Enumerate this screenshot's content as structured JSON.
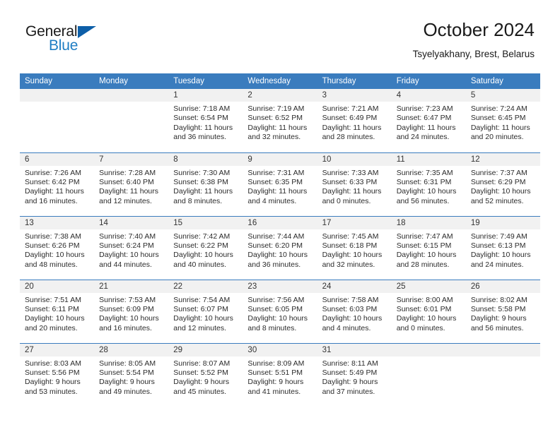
{
  "brand": {
    "name_part1": "General",
    "name_part2": "Blue",
    "triangle_color": "#0d5fa8",
    "blue_color": "#1f7ec4"
  },
  "header": {
    "title": "October 2024",
    "subtitle": "Tsyelyakhany, Brest, Belarus"
  },
  "theme": {
    "header_blue": "#3a7cbe",
    "daynum_gray": "#f1f1f1",
    "text": "#2b2b2b"
  },
  "weekdays": [
    "Sunday",
    "Monday",
    "Tuesday",
    "Wednesday",
    "Thursday",
    "Friday",
    "Saturday"
  ],
  "weeks": [
    [
      {
        "day": "",
        "blank": true
      },
      {
        "day": "",
        "blank": true
      },
      {
        "day": "1",
        "sunrise": "Sunrise: 7:18 AM",
        "sunset": "Sunset: 6:54 PM",
        "daylight": "Daylight: 11 hours and 36 minutes."
      },
      {
        "day": "2",
        "sunrise": "Sunrise: 7:19 AM",
        "sunset": "Sunset: 6:52 PM",
        "daylight": "Daylight: 11 hours and 32 minutes."
      },
      {
        "day": "3",
        "sunrise": "Sunrise: 7:21 AM",
        "sunset": "Sunset: 6:49 PM",
        "daylight": "Daylight: 11 hours and 28 minutes."
      },
      {
        "day": "4",
        "sunrise": "Sunrise: 7:23 AM",
        "sunset": "Sunset: 6:47 PM",
        "daylight": "Daylight: 11 hours and 24 minutes."
      },
      {
        "day": "5",
        "sunrise": "Sunrise: 7:24 AM",
        "sunset": "Sunset: 6:45 PM",
        "daylight": "Daylight: 11 hours and 20 minutes."
      }
    ],
    [
      {
        "day": "6",
        "sunrise": "Sunrise: 7:26 AM",
        "sunset": "Sunset: 6:42 PM",
        "daylight": "Daylight: 11 hours and 16 minutes."
      },
      {
        "day": "7",
        "sunrise": "Sunrise: 7:28 AM",
        "sunset": "Sunset: 6:40 PM",
        "daylight": "Daylight: 11 hours and 12 minutes."
      },
      {
        "day": "8",
        "sunrise": "Sunrise: 7:30 AM",
        "sunset": "Sunset: 6:38 PM",
        "daylight": "Daylight: 11 hours and 8 minutes."
      },
      {
        "day": "9",
        "sunrise": "Sunrise: 7:31 AM",
        "sunset": "Sunset: 6:35 PM",
        "daylight": "Daylight: 11 hours and 4 minutes."
      },
      {
        "day": "10",
        "sunrise": "Sunrise: 7:33 AM",
        "sunset": "Sunset: 6:33 PM",
        "daylight": "Daylight: 11 hours and 0 minutes."
      },
      {
        "day": "11",
        "sunrise": "Sunrise: 7:35 AM",
        "sunset": "Sunset: 6:31 PM",
        "daylight": "Daylight: 10 hours and 56 minutes."
      },
      {
        "day": "12",
        "sunrise": "Sunrise: 7:37 AM",
        "sunset": "Sunset: 6:29 PM",
        "daylight": "Daylight: 10 hours and 52 minutes."
      }
    ],
    [
      {
        "day": "13",
        "sunrise": "Sunrise: 7:38 AM",
        "sunset": "Sunset: 6:26 PM",
        "daylight": "Daylight: 10 hours and 48 minutes."
      },
      {
        "day": "14",
        "sunrise": "Sunrise: 7:40 AM",
        "sunset": "Sunset: 6:24 PM",
        "daylight": "Daylight: 10 hours and 44 minutes."
      },
      {
        "day": "15",
        "sunrise": "Sunrise: 7:42 AM",
        "sunset": "Sunset: 6:22 PM",
        "daylight": "Daylight: 10 hours and 40 minutes."
      },
      {
        "day": "16",
        "sunrise": "Sunrise: 7:44 AM",
        "sunset": "Sunset: 6:20 PM",
        "daylight": "Daylight: 10 hours and 36 minutes."
      },
      {
        "day": "17",
        "sunrise": "Sunrise: 7:45 AM",
        "sunset": "Sunset: 6:18 PM",
        "daylight": "Daylight: 10 hours and 32 minutes."
      },
      {
        "day": "18",
        "sunrise": "Sunrise: 7:47 AM",
        "sunset": "Sunset: 6:15 PM",
        "daylight": "Daylight: 10 hours and 28 minutes."
      },
      {
        "day": "19",
        "sunrise": "Sunrise: 7:49 AM",
        "sunset": "Sunset: 6:13 PM",
        "daylight": "Daylight: 10 hours and 24 minutes."
      }
    ],
    [
      {
        "day": "20",
        "sunrise": "Sunrise: 7:51 AM",
        "sunset": "Sunset: 6:11 PM",
        "daylight": "Daylight: 10 hours and 20 minutes."
      },
      {
        "day": "21",
        "sunrise": "Sunrise: 7:53 AM",
        "sunset": "Sunset: 6:09 PM",
        "daylight": "Daylight: 10 hours and 16 minutes."
      },
      {
        "day": "22",
        "sunrise": "Sunrise: 7:54 AM",
        "sunset": "Sunset: 6:07 PM",
        "daylight": "Daylight: 10 hours and 12 minutes."
      },
      {
        "day": "23",
        "sunrise": "Sunrise: 7:56 AM",
        "sunset": "Sunset: 6:05 PM",
        "daylight": "Daylight: 10 hours and 8 minutes."
      },
      {
        "day": "24",
        "sunrise": "Sunrise: 7:58 AM",
        "sunset": "Sunset: 6:03 PM",
        "daylight": "Daylight: 10 hours and 4 minutes."
      },
      {
        "day": "25",
        "sunrise": "Sunrise: 8:00 AM",
        "sunset": "Sunset: 6:01 PM",
        "daylight": "Daylight: 10 hours and 0 minutes."
      },
      {
        "day": "26",
        "sunrise": "Sunrise: 8:02 AM",
        "sunset": "Sunset: 5:58 PM",
        "daylight": "Daylight: 9 hours and 56 minutes."
      }
    ],
    [
      {
        "day": "27",
        "sunrise": "Sunrise: 8:03 AM",
        "sunset": "Sunset: 5:56 PM",
        "daylight": "Daylight: 9 hours and 53 minutes."
      },
      {
        "day": "28",
        "sunrise": "Sunrise: 8:05 AM",
        "sunset": "Sunset: 5:54 PM",
        "daylight": "Daylight: 9 hours and 49 minutes."
      },
      {
        "day": "29",
        "sunrise": "Sunrise: 8:07 AM",
        "sunset": "Sunset: 5:52 PM",
        "daylight": "Daylight: 9 hours and 45 minutes."
      },
      {
        "day": "30",
        "sunrise": "Sunrise: 8:09 AM",
        "sunset": "Sunset: 5:51 PM",
        "daylight": "Daylight: 9 hours and 41 minutes."
      },
      {
        "day": "31",
        "sunrise": "Sunrise: 8:11 AM",
        "sunset": "Sunset: 5:49 PM",
        "daylight": "Daylight: 9 hours and 37 minutes."
      },
      {
        "day": "",
        "blank": true
      },
      {
        "day": "",
        "blank": true
      }
    ]
  ]
}
